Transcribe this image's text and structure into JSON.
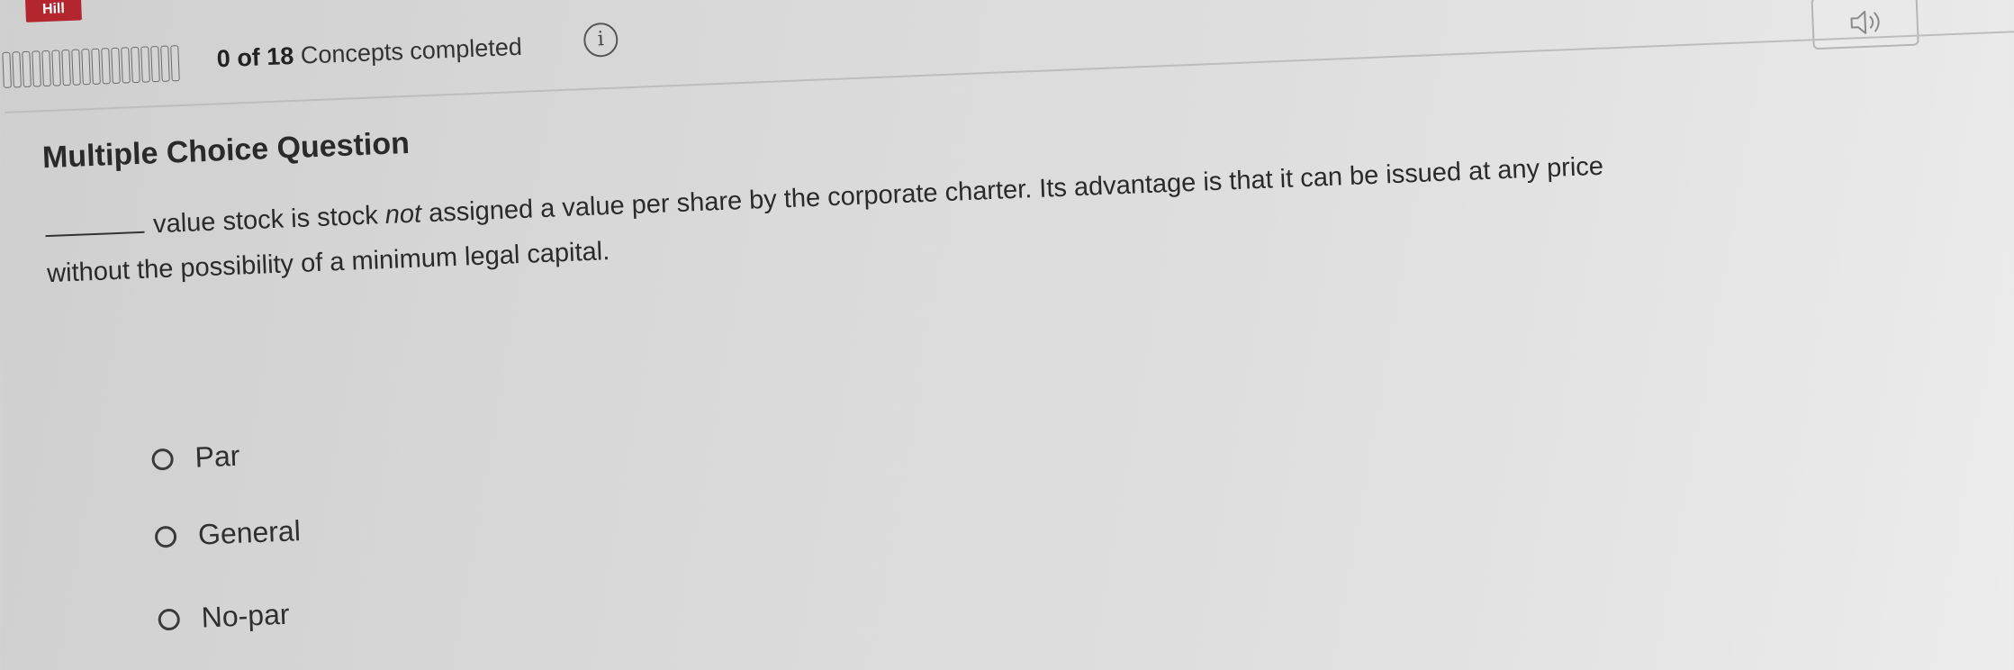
{
  "header": {
    "brand_text": "Hill",
    "progress": {
      "completed": "0",
      "of_word": "of",
      "total": "18",
      "suffix": "Concepts completed",
      "fraction": 0.0
    },
    "info_icon": "info-icon",
    "audio_icon": "speaker-icon"
  },
  "question": {
    "heading": "Multiple Choice Question",
    "blank": "_______",
    "text_part1": "value stock is stock ",
    "text_emphasis": "not",
    "text_part2": " assigned a value per share by the corporate charter. Its advantage is that it can be issued at any price",
    "text_line2": "without the possibility of a minimum legal capital."
  },
  "options": [
    {
      "label": "Par",
      "selected": false
    },
    {
      "label": "General",
      "selected": false
    },
    {
      "label": "No-par",
      "selected": false
    }
  ],
  "colors": {
    "brand": "#b3262d",
    "text": "#2a2a2a",
    "background": "#dcdcdc"
  }
}
